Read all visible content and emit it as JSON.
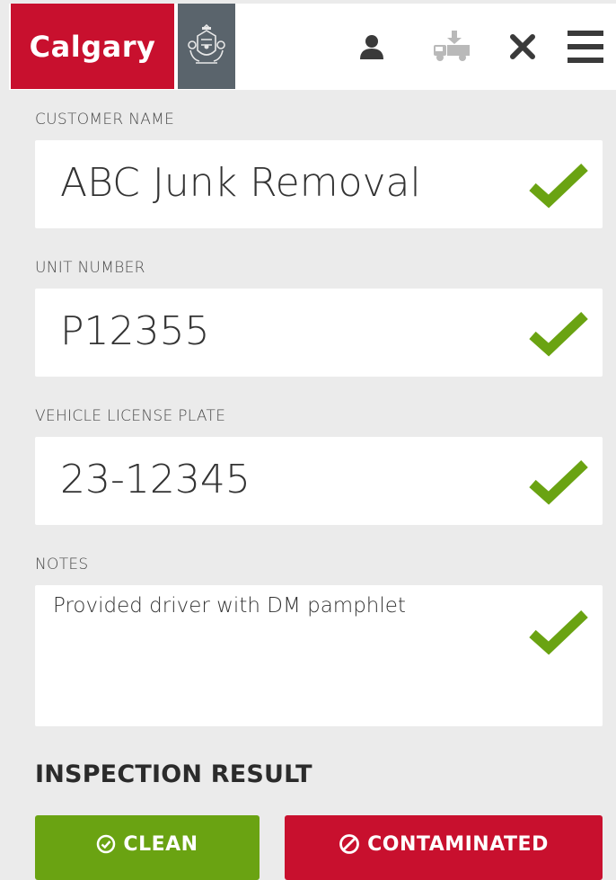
{
  "header": {
    "brand_text": "Calgary",
    "crest_icon": "city-crest-icon",
    "icons": [
      "user-icon",
      "truck-unload-icon",
      "close-icon",
      "menu-icon"
    ],
    "brand_color": "#c8102e",
    "crest_bg": "#5a646c"
  },
  "form": {
    "customer_name": {
      "label": "CUSTOMER NAME",
      "value": "ABC Junk Removal",
      "valid": true
    },
    "unit_number": {
      "label": "UNIT NUMBER",
      "value": "P12355",
      "valid": true
    },
    "license_plate": {
      "label": "VEHICLE LICENSE PLATE",
      "value": "23-12345",
      "valid": true
    },
    "notes": {
      "label": "NOTES",
      "value": "Provided driver with DM pamphlet",
      "valid": true
    },
    "check_color": "#6aa312"
  },
  "inspection": {
    "title": "INSPECTION RESULT",
    "clean_label": "CLEAN",
    "contaminated_label": "CONTAMINATED",
    "clean_color": "#6aa312",
    "contaminated_color": "#c8102e"
  }
}
